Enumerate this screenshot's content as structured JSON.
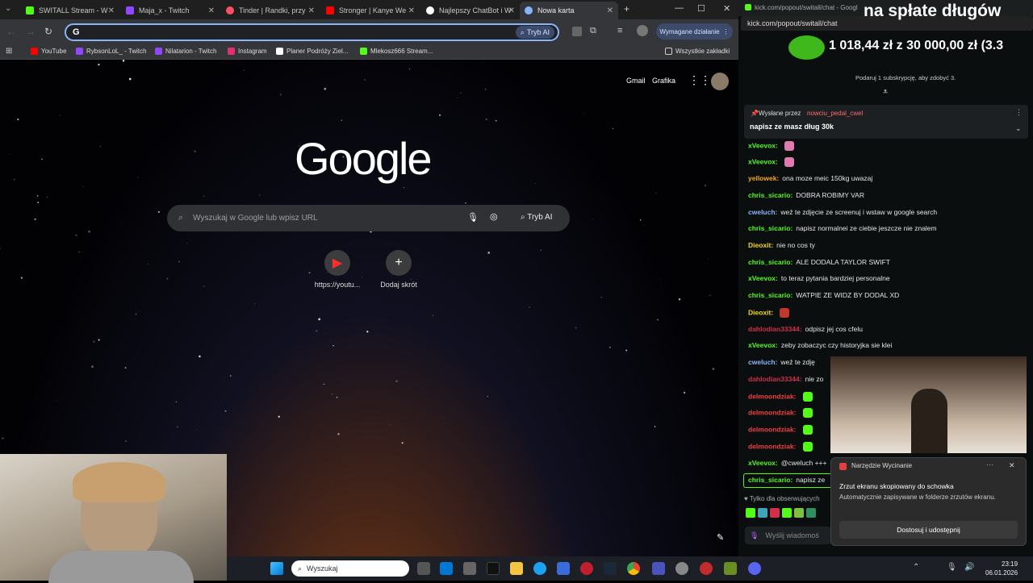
{
  "tabs": [
    {
      "label": "SWITALL Stream - W",
      "color": "#53fc18"
    },
    {
      "label": "Maja_x - Twitch",
      "color": "#9146ff"
    },
    {
      "label": "Tinder | Randki, przy",
      "color": "#fd5068"
    },
    {
      "label": "Stronger | Kanye We",
      "color": "#ff0000"
    },
    {
      "label": "Najlepszy ChatBot i W",
      "color": "#ffffff"
    },
    {
      "label": "Nowa karta",
      "color": "#8ab4f8"
    }
  ],
  "toolbar": {
    "omnibox_value": "",
    "omnibox_ai": "Tryb AI",
    "action_required": "Wymagane działanie"
  },
  "bookmarks": [
    {
      "label": "YouTube",
      "color": "#ff0000"
    },
    {
      "label": "RybsonLoL_ - Twitch",
      "color": "#9146ff"
    },
    {
      "label": "Nilatarion - Twitch",
      "color": "#9146ff"
    },
    {
      "label": "Instagram",
      "color": "#e1306c"
    },
    {
      "label": "Planer Podróży Ziel...",
      "color": "#ffffff"
    },
    {
      "label": "Mlekosz666 Stream...",
      "color": "#53fc18"
    }
  ],
  "bookmarks_all": "Wszystkie zakładki",
  "ntp": {
    "gmail": "Gmail",
    "images": "Grafika",
    "logo": "Google",
    "search_placeholder": "Wyszukaj w Google lub wpisz URL",
    "ai_mode": "Tryb AI",
    "shortcuts": [
      {
        "label": "https://youtu...",
        "icon": "youtube-icon"
      },
      {
        "label": "Dodaj skrót",
        "icon": "plus-icon"
      }
    ]
  },
  "chat": {
    "url": "kick.com/popout/switall/chat - Googl",
    "overlay_title": "na spłate długów",
    "goal": "1 018,44 zł z 30 000,00 zł (3.3",
    "sub_prompt": "Podaruj 1 subskrypcję, aby zdobyć 3.",
    "pinned_by_label": "Wysłane przez",
    "pinned_by": "nowciu_pedal_cwel",
    "pinned_text": "napisz ze masz dług 30k",
    "messages": [
      {
        "user": "xVeevox:",
        "text": "",
        "color": "#53fc18"
      },
      {
        "user": "xVeevox:",
        "text": "",
        "color": "#53fc18"
      },
      {
        "user": "yellowek:",
        "text": "ona moze meic 150kg uwazaj",
        "color": "#f5a623"
      },
      {
        "user": "chris_sicario:",
        "text": "DOBRA ROBIMY VAR",
        "color": "#53fc18"
      },
      {
        "user": "cweluch:",
        "text": "weź te zdjęcie ze screenuj i wstaw w google search",
        "color": "#8ab4f8"
      },
      {
        "user": "chris_sicario:",
        "text": "napisz normalnei ze ciebie jeszcze nie znalem",
        "color": "#53fc18"
      },
      {
        "user": "Dieoxit:",
        "text": "nie no cos ty",
        "color": "#f5d90a"
      },
      {
        "user": "chris_sicario:",
        "text": "ALE DODALA TAYLOR SWIFT",
        "color": "#53fc18"
      },
      {
        "user": "xVeevox:",
        "text": "to teraz pytania bardziej personalne",
        "color": "#53fc18"
      },
      {
        "user": "chris_sicario:",
        "text": "WATPIE ZE WIDZ BY DODAL XD",
        "color": "#53fc18"
      },
      {
        "user": "Dieoxit:",
        "text": "",
        "color": "#f5d90a"
      },
      {
        "user": "dahlodian33344:",
        "text": "odpisz jej cos cfelu",
        "color": "#d0304a"
      },
      {
        "user": "xVeevox:",
        "text": "zeby zobaczyc czy historyjka sie klei",
        "color": "#53fc18"
      },
      {
        "user": "cweluch:",
        "text": "weź te zdję",
        "color": "#8ab4f8"
      },
      {
        "user": "dahlodian33344:",
        "text": "nie zo",
        "color": "#d0304a"
      },
      {
        "user": "delmoondziak:",
        "text": "",
        "color": "#f04040"
      },
      {
        "user": "delmoondziak:",
        "text": "",
        "color": "#f04040"
      },
      {
        "user": "delmoondziak:",
        "text": "",
        "color": "#f04040"
      },
      {
        "user": "delmoondziak:",
        "text": "",
        "color": "#f04040"
      },
      {
        "user": "xVeevox:",
        "text": "@cweluch +++",
        "color": "#53fc18"
      },
      {
        "user": "chris_sicario:",
        "text": "napisz ze",
        "color": "#53fc18"
      }
    ],
    "followers_only": "Tylko dla obserwujących",
    "input_placeholder": "Wyślij wiadomoś"
  },
  "snip_toast": {
    "app": "Narzędzie Wycinanie",
    "title": "Zrzut ekranu skopiowany do schowka",
    "body": "Automatycznie zapisywane w folderze zrzutów ekranu.",
    "button": "Dostosuj i udostępnij"
  },
  "taskbar": {
    "search_placeholder": "Wyszukaj",
    "time": "23:19",
    "date": "06.01.2026"
  }
}
